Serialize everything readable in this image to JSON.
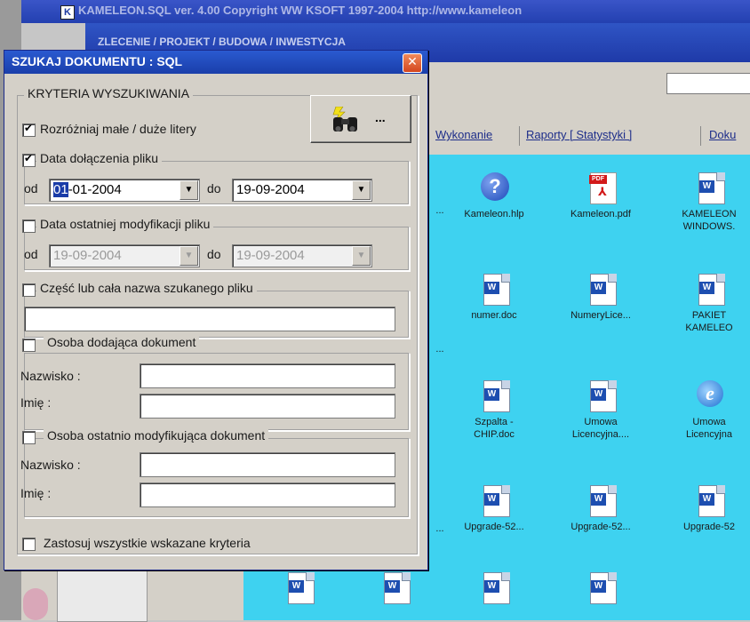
{
  "background": {
    "app_title": "KAMELEON.SQL ver. 4.00 Copyright WW KSOFT 1997-2004 http://www.kameleon",
    "app_icon": "K",
    "subtitle": "ZLECENIE / PROJEKT / BUDOWA / INWESTYCJA",
    "tabs": [
      "Wykonanie",
      "Raporty [ Statystyki ]",
      "Doku"
    ],
    "files": [
      {
        "label": "...",
        "icon": "none"
      },
      {
        "label": "Kameleon.hlp",
        "icon": "help-icon"
      },
      {
        "label": "Kameleon.pdf",
        "icon": "pdf-icon"
      },
      {
        "label": "KAMELEON WINDOWS.",
        "icon": "word-doc-icon"
      },
      {
        "label": "...",
        "icon": "none"
      },
      {
        "label": "numer.doc",
        "icon": "word-doc-icon"
      },
      {
        "label": "NumeryLice...",
        "icon": "word-doc-icon"
      },
      {
        "label": "PAKIET KAMELEO",
        "icon": "word-doc-icon"
      },
      {
        "label": "Szpalta - CHIP.doc",
        "icon": "word-doc-icon"
      },
      {
        "label": "Umowa Licencyjna....",
        "icon": "word-doc-icon"
      },
      {
        "label": "Umowa Licencyjna",
        "icon": "ie-icon"
      },
      {
        "label": "...",
        "icon": "none"
      },
      {
        "label": "Upgrade-52...",
        "icon": "word-doc-icon"
      },
      {
        "label": "Upgrade-52...",
        "icon": "word-doc-icon"
      },
      {
        "label": "Upgrade-52",
        "icon": "word-doc-icon"
      }
    ]
  },
  "dialog": {
    "title": "SZUKAJ DOKUMENTU : SQL",
    "close_symbol": "✕",
    "criteria_legend": "KRYTERIA WYSZUKIWANIA",
    "case_sensitive": {
      "label": "Rozróżniaj małe / duże litery",
      "checked": true
    },
    "search_button_dots": "...",
    "date_added": {
      "label": "Data dołączenia pliku",
      "checked": true,
      "from_label": "od",
      "from_sel": "01",
      "from_rest": "-01-2004",
      "to_label": "do",
      "to_value": "19-09-2004"
    },
    "date_modified": {
      "label": "Data ostatniej modyfikacji pliku",
      "checked": false,
      "from_label": "od",
      "from_value": "19-09-2004",
      "to_label": "do",
      "to_value": "19-09-2004"
    },
    "file_name": {
      "label": "Część lub cała nazwa szukanego pliku",
      "checked": false,
      "value": ""
    },
    "added_by": {
      "label": "Osoba dodająca dokument",
      "checked": false,
      "surname_label": "Nazwisko :",
      "name_label": "Imię :"
    },
    "modified_by": {
      "label": "Osoba ostatnio modyfikująca dokument",
      "checked": false,
      "surname_label": "Nazwisko :",
      "name_label": "Imię :"
    },
    "apply_all": {
      "label": "Zastosuj wszystkie wskazane kryteria",
      "checked": false
    }
  },
  "colors": {
    "titlebar": "#1a3eaa",
    "files_bg": "#3ed2f0",
    "dialog_bg": "#d4d0c8",
    "close_btn": "#d4461e"
  }
}
